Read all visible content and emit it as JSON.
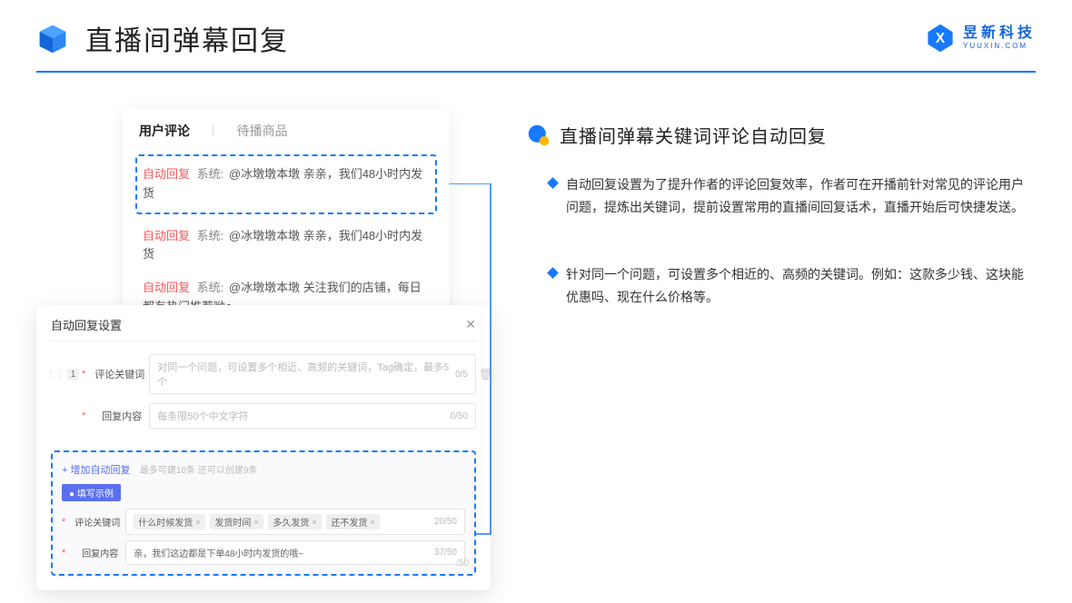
{
  "header": {
    "title": "直播间弹幕回复",
    "brand_cn": "昱新科技",
    "brand_en": "YUUXIN.COM"
  },
  "comments_card": {
    "tab_active": "用户评论",
    "tab_inactive": "待播商品",
    "rows": [
      {
        "auto": "自动回复",
        "sys": "系统:",
        "text": "@冰墩墩本墩 亲亲，我们48小时内发货"
      },
      {
        "auto": "自动回复",
        "sys": "系统:",
        "text": "@冰墩墩本墩 亲亲，我们48小时内发货"
      },
      {
        "auto": "自动回复",
        "sys": "系统:",
        "text": "@冰墩墩本墩 关注我们的店铺，每日都有热门推荐呦～"
      }
    ]
  },
  "settings": {
    "title": "自动回复设置",
    "index": "1",
    "row1_label": "评论关键词",
    "row1_placeholder": "对同一个问题，可设置多个相近、高频的关键词，Tag确定，最多5个",
    "row1_counter": "0/5",
    "row2_label": "回复内容",
    "row2_placeholder": "每条限50个中文字符",
    "row2_counter": "0/50",
    "add_link": "+ 增加自动回复",
    "add_hint": "最多可建10条 还可以创建9条",
    "example_tag": "● 填写示例",
    "ex_row1_label": "评论关键词",
    "ex_tags": [
      "什么时候发货",
      "发货时间",
      "多久发货",
      "还不发货"
    ],
    "ex_row1_counter": "20/50",
    "ex_row2_label": "回复内容",
    "ex_row2_value": "亲，我们这边都是下单48小时内发货的哦~",
    "ex_row2_counter": "37/50",
    "faded_counter": "/50"
  },
  "right": {
    "heading": "直播间弹幕关键词评论自动回复",
    "bullets": [
      "自动回复设置为了提升作者的评论回复效率，作者可在开播前针对常见的评论用户问题，提炼出关键词，提前设置常用的直播间回复话术，直播开始后可快捷发送。",
      "针对同一个问题，可设置多个相近的、高频的关键词。例如：这款多少钱、这块能优惠吗、现在什么价格等。"
    ]
  }
}
